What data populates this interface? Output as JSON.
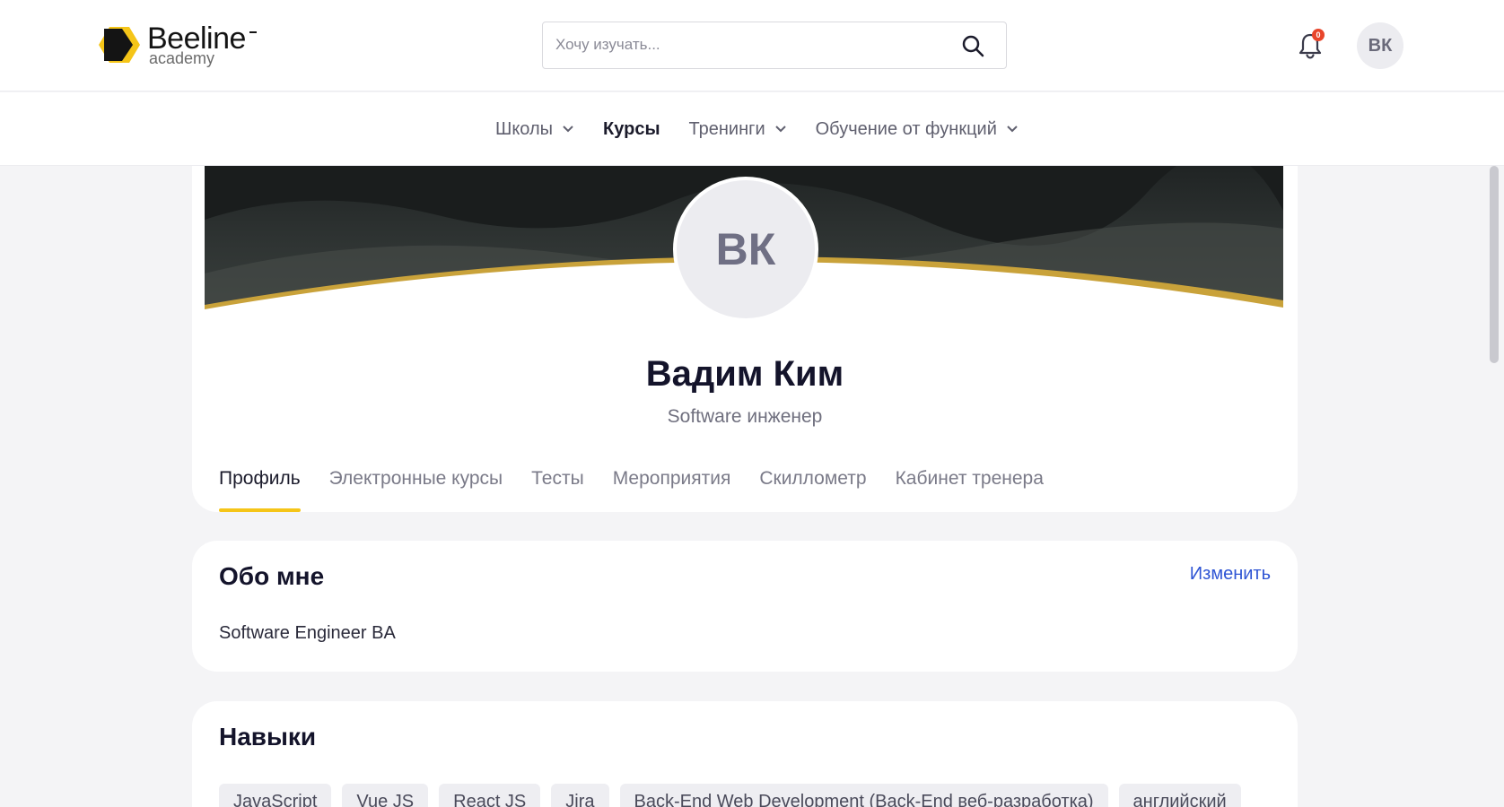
{
  "header": {
    "logo_title": "Beeline",
    "logo_sub": "academy",
    "search_placeholder": "Хочу изучать...",
    "notification_count": "0",
    "user_initials": "ВК"
  },
  "nav": {
    "items": [
      {
        "label": "Школы"
      },
      {
        "label": "Курсы"
      },
      {
        "label": "Тренинги"
      },
      {
        "label": "Обучение от функций"
      }
    ]
  },
  "profile": {
    "initials": "ВК",
    "name": "Вадим Ким",
    "role": "Software инженер",
    "tabs": [
      {
        "label": "Профиль"
      },
      {
        "label": "Электронные курсы"
      },
      {
        "label": "Тесты"
      },
      {
        "label": "Мероприятия"
      },
      {
        "label": "Скиллометр"
      },
      {
        "label": "Кабинет тренера"
      }
    ]
  },
  "about": {
    "title": "Обо мне",
    "edit_label": "Изменить",
    "text": "Software Engineer BA"
  },
  "skills": {
    "title": "Навыки",
    "items": [
      "JavaScript",
      "Vue JS",
      "React JS",
      "Jira",
      "Back-End Web Development (Back-End веб-разработка)",
      "английский"
    ]
  },
  "colors": {
    "accent": "#f5c518",
    "link": "#2f55d4",
    "badge": "#e8452b"
  },
  "icons": [
    "beeline-logo-icon",
    "search-icon",
    "bell-icon",
    "chevron-down-icon"
  ]
}
